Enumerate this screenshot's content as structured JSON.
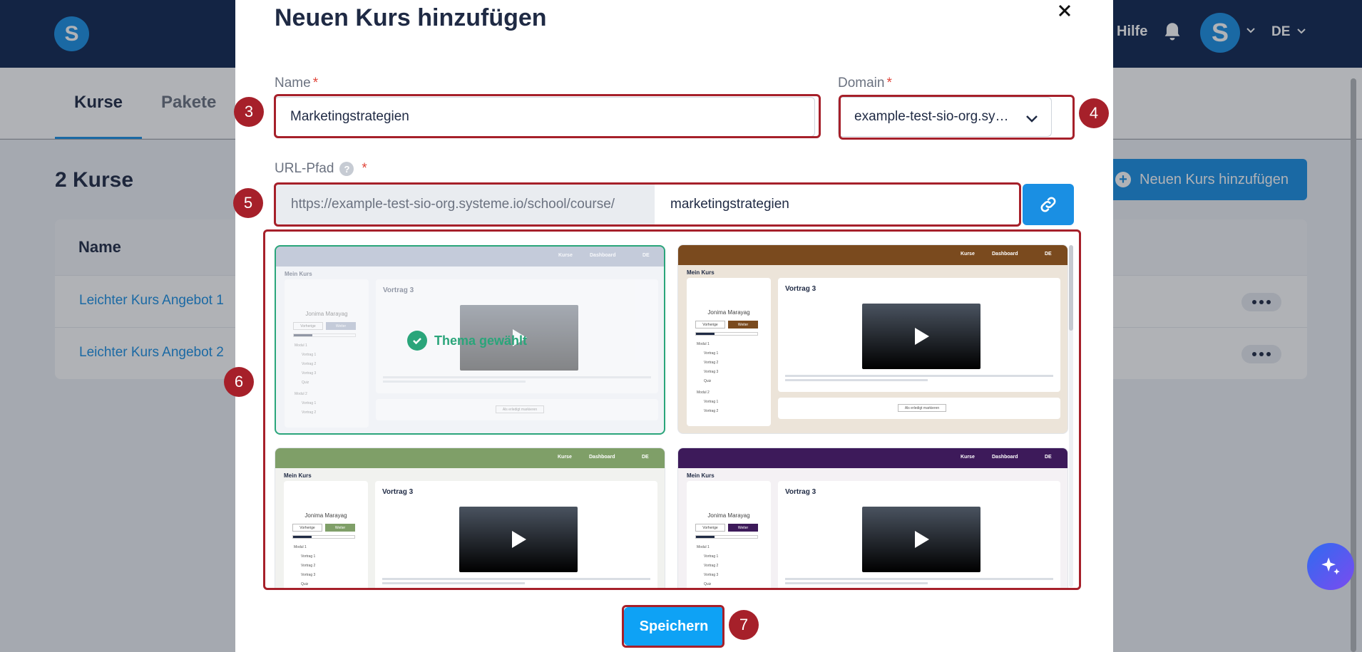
{
  "app": {
    "logo_letter": "S",
    "topbar": {
      "help": "Hilfe",
      "avatar_letter": "S",
      "language": "DE"
    },
    "tabs": [
      {
        "label": "Kurse"
      },
      {
        "label": "Pakete"
      }
    ],
    "course_count": "2 Kurse",
    "add_course_button": "Neuen Kurs hinzufügen",
    "table": {
      "header_name": "Name",
      "rows": [
        {
          "name": "Leichter Kurs Angebot 1"
        },
        {
          "name": "Leichter Kurs Angebot 2"
        }
      ]
    }
  },
  "modal": {
    "title": "Neuen Kurs hinzufügen",
    "name_label": "Name",
    "name_value": "Marketingstrategien",
    "domain_label": "Domain",
    "domain_value": "example-test-sio-org.systeme.io",
    "url_label": "URL-Pfad",
    "help_glyph": "?",
    "required_mark": "*",
    "url_prefix": "https://example-test-sio-org.systeme.io/school/course/",
    "url_slug": "marketingstrategien",
    "theme_selected_label": "Thema gewählt",
    "save_button": "Speichern",
    "themes": [
      {
        "accent": "#8e9bb5",
        "bg": "#f1f3f7",
        "selected": true
      },
      {
        "accent": "#7a4a1e",
        "bg": "#ece4d9",
        "selected": false
      },
      {
        "accent": "#7f9f68",
        "bg": "#f1f2ef",
        "selected": false
      },
      {
        "accent": "#3d1a5a",
        "bg": "#f4f1f4",
        "selected": false
      }
    ],
    "preview": {
      "nav_courses": "Kurse",
      "nav_dashboard": "Dashboard",
      "nav_lang": "DE",
      "course_title": "Mein Kurs",
      "author": "Jonima Marayag",
      "prev": "Vorherige",
      "next": "Weiter",
      "progress": "38%",
      "lecture": "Vortrag 3",
      "module1": "Modul 1",
      "module2": "Modul 2",
      "item1": "Vortrag 1",
      "item2": "Vortrag 2",
      "item3": "Vortrag 3",
      "quiz": "Quiz",
      "mark_done": "Als erledigt markieren"
    }
  },
  "annotations": {
    "n3": "3",
    "n4": "4",
    "n5": "5",
    "n6": "6",
    "n7": "7"
  },
  "colors": {
    "primary": "#1a8fe3",
    "navy": "#0e2551",
    "success": "#2aa57a",
    "annotation": "#a6202a"
  }
}
